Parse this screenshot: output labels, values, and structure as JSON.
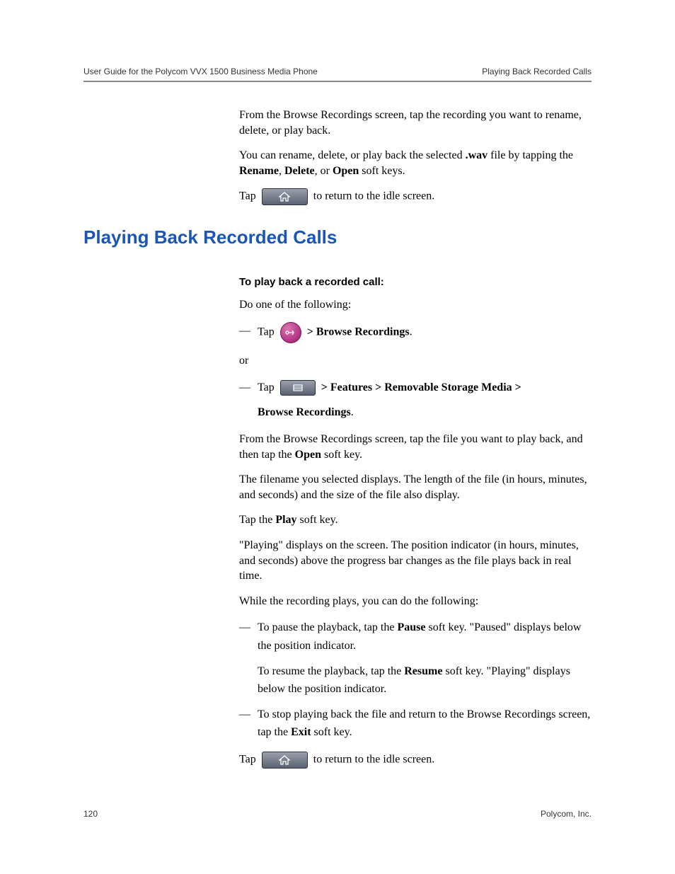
{
  "header": {
    "left": "User Guide for the Polycom VVX 1500 Business Media Phone",
    "right": "Playing Back Recorded Calls"
  },
  "intro": {
    "para1": "From the Browse Recordings screen, tap the recording you want to rename, delete, or play back.",
    "para2_pre": "You can rename, delete, or play back the selected ",
    "para2_wav": ".wav",
    "para2_mid": " file by tapping the ",
    "para2_rename": "Rename",
    "para2_comma1": ", ",
    "para2_delete": "Delete",
    "para2_comma2": ", or ",
    "para2_open": "Open",
    "para2_post": " soft keys.",
    "tap_label": "Tap ",
    "return_idle": " to return to the idle screen."
  },
  "section": {
    "heading": "Playing Back Recorded Calls",
    "subheading": "To play back a recorded call:",
    "do_one": "Do one of the following:",
    "opt1_tap": "Tap ",
    "opt1_browse": " > Browse Recordings",
    "opt1_dot": ".",
    "or": "or",
    "opt2_tap": "Tap ",
    "opt2_path_a": " > Features > Removable Storage Media > ",
    "opt2_path_b": "Browse Recordings",
    "opt2_dot": ".",
    "p3_pre": "From the Browse Recordings screen, tap the file you want to play back, and then tap the ",
    "p3_open": "Open",
    "p3_post": " soft key.",
    "p4": "The filename you selected displays. The length of the file (in hours, minutes, and seconds) and the size of the file also display.",
    "p5_pre": "Tap the ",
    "p5_play": "Play",
    "p5_post": " soft key.",
    "p6": "\"Playing\" displays on the screen. The position indicator (in hours, minutes, and seconds) above the progress bar changes as the file plays back in real time.",
    "p7": "While the recording plays, you can do the following:",
    "b1_pre": "To pause the playback, tap the ",
    "b1_pause": "Pause",
    "b1_post": " soft key. \"Paused\" displays below the position indicator.",
    "b1b_pre": "To resume the playback, tap the ",
    "b1b_resume": "Resume",
    "b1b_post": " soft key. \"Playing\" displays below the position indicator.",
    "b2_pre": "To stop playing back the file and return to the Browse Recordings screen, tap the ",
    "b2_exit": "Exit",
    "b2_post": " soft key.",
    "tap_label2": "Tap ",
    "return_idle2": " to return to the idle screen."
  },
  "footer": {
    "page_number": "120",
    "company": "Polycom, Inc."
  }
}
